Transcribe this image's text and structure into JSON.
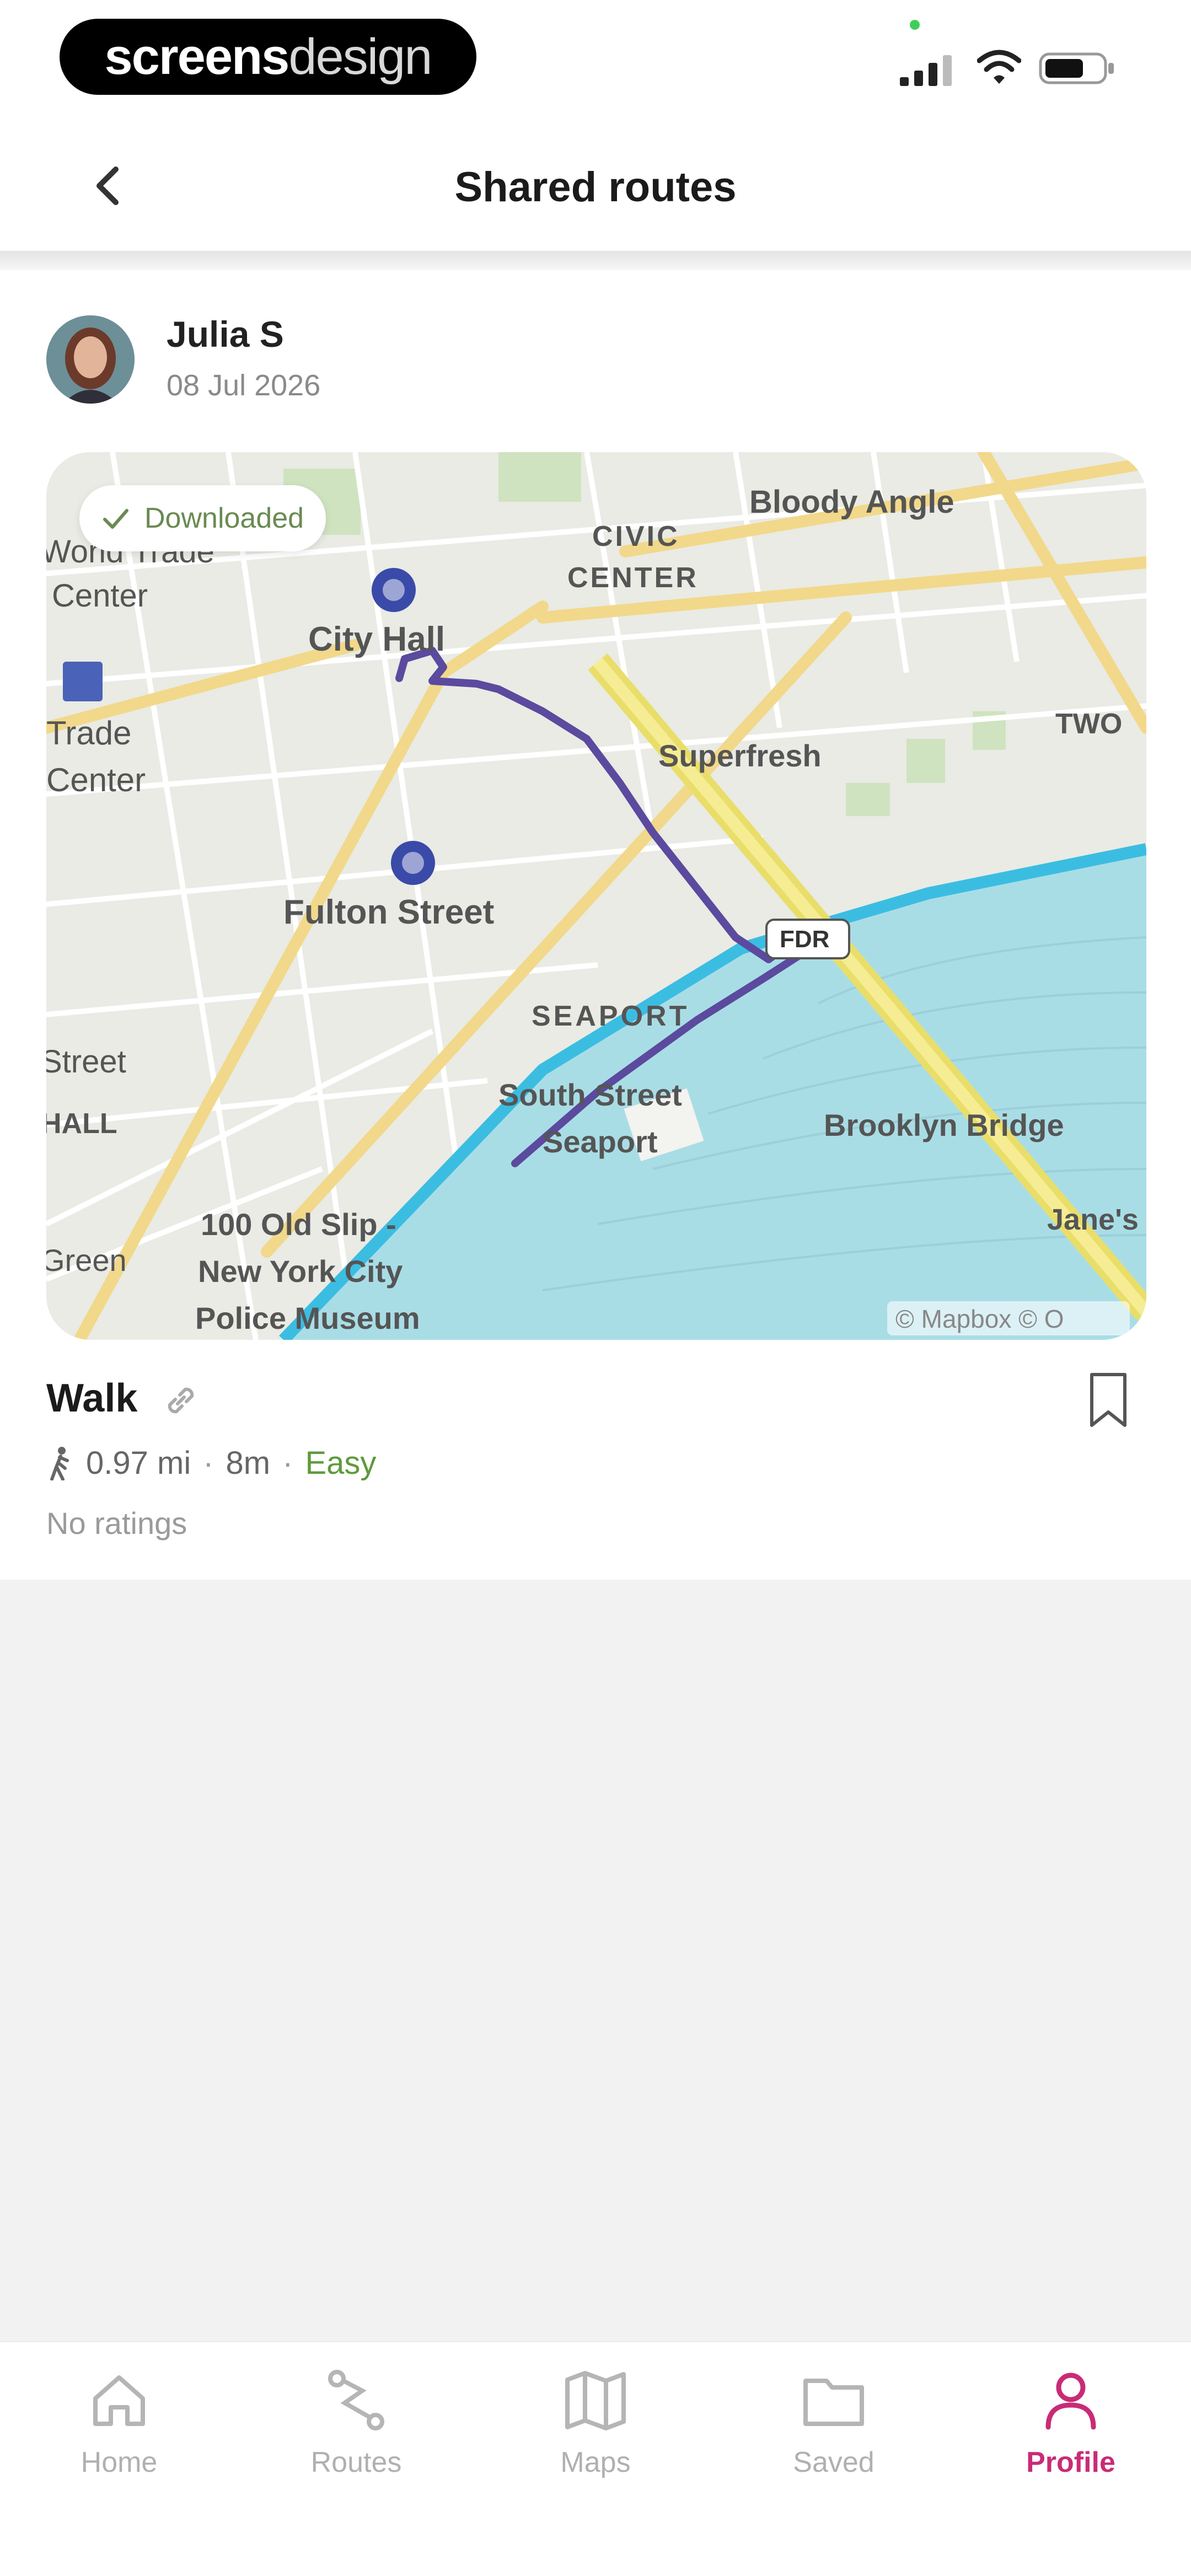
{
  "status_bar": {
    "brand_part1": "screens",
    "brand_part2": "design",
    "icons": [
      "signal-icon",
      "wifi-icon",
      "battery-icon"
    ]
  },
  "header": {
    "title": "Shared routes",
    "back_icon": "chevron-left-icon"
  },
  "post": {
    "user_name": "Julia S",
    "date": "08 Jul 2026",
    "badge_label": "Downloaded",
    "map": {
      "labels": [
        "Bloody Angle",
        "CIVIC",
        "CENTER",
        "City Hall",
        "World Trade",
        "Center",
        "Trade",
        "Center",
        "Superfresh",
        "TWO",
        "Fulton Street",
        "FDR",
        "SEAPORT",
        "Street",
        "HALL",
        "South Street",
        "Seaport",
        "Brooklyn Bridge",
        "Jane's",
        "100 Old Slip -",
        "New York City",
        "Police Museum",
        "Green",
        "© Mapbox © O"
      ]
    },
    "route": {
      "title": "Walk",
      "distance": "0.97 mi",
      "duration": "8m",
      "difficulty": "Easy",
      "ratings": "No ratings",
      "separator": "·"
    }
  },
  "colors": {
    "accent": "#c92b77",
    "easy": "#5e9b3b",
    "route_line": "#5b4a9e",
    "water": "#a9dde6",
    "bridge": "#f0e27a"
  },
  "bottom_nav": {
    "items": [
      {
        "label": "Home",
        "icon": "home-icon"
      },
      {
        "label": "Routes",
        "icon": "routes-icon"
      },
      {
        "label": "Maps",
        "icon": "map-icon"
      },
      {
        "label": "Saved",
        "icon": "folder-icon"
      },
      {
        "label": "Profile",
        "icon": "profile-icon",
        "active": true
      }
    ]
  }
}
